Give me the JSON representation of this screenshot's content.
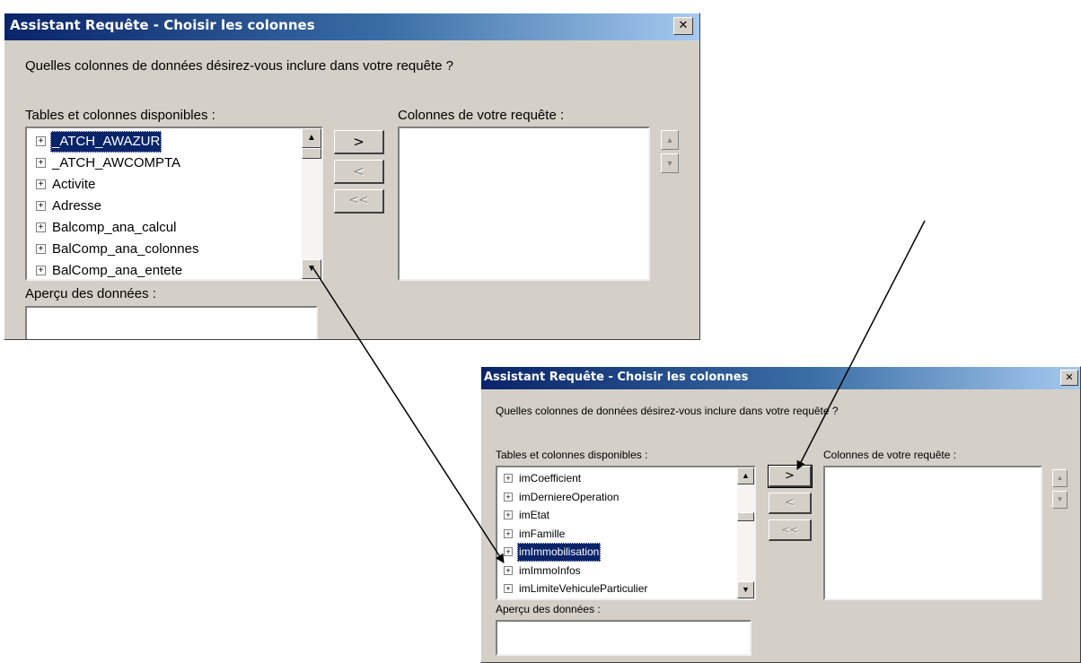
{
  "dialog1": {
    "title": "Assistant Requête - Choisir les colonnes",
    "close_glyph": "✕",
    "question": "Quelles colonnes de données désirez-vous inclure dans votre requête ?",
    "available_label": "Tables et colonnes disponibles :",
    "query_label": "Colonnes de votre requête :",
    "preview_label": "Aperçu des données :",
    "tree_items": [
      {
        "expander": "+",
        "label": "_ATCH_AWAZUR"
      },
      {
        "expander": "+",
        "label": "_ATCH_AWCOMPTA"
      },
      {
        "expander": "+",
        "label": "Activite"
      },
      {
        "expander": "+",
        "label": "Adresse"
      },
      {
        "expander": "+",
        "label": "Balcomp_ana_calcul"
      },
      {
        "expander": "+",
        "label": "BalComp_ana_colonnes"
      },
      {
        "expander": "+",
        "label": "BalComp_ana_entete"
      }
    ],
    "selected_index": 0,
    "buttons": {
      "add": ">",
      "remove": "<",
      "remove_all": "<<"
    },
    "move_up": "▲",
    "move_down": "▼"
  },
  "dialog2": {
    "title": "Assistant Requête - Choisir les colonnes",
    "close_glyph": "✕",
    "question": "Quelles colonnes de données désirez-vous inclure dans votre requête ?",
    "available_label": "Tables et colonnes disponibles :",
    "query_label": "Colonnes de votre requête :",
    "preview_label": "Aperçu des données :",
    "tree_items": [
      {
        "expander": "+",
        "label": "imCoefficient"
      },
      {
        "expander": "+",
        "label": "imDerniereOperation"
      },
      {
        "expander": "+",
        "label": "imEtat"
      },
      {
        "expander": "+",
        "label": "imFamille"
      },
      {
        "expander": "+",
        "label": "imImmobilisation"
      },
      {
        "expander": "+",
        "label": "imImmoInfos"
      },
      {
        "expander": "+",
        "label": "imLimiteVehiculeParticulier"
      }
    ],
    "selected_index": 4,
    "buttons": {
      "add": ">",
      "remove": "<",
      "remove_all": "<<"
    },
    "move_up": "▲",
    "move_down": "▼"
  },
  "scroll_glyphs": {
    "up": "▲",
    "down": "▼"
  },
  "colors": {
    "dialog_bg": "#d4d0c8",
    "title_start": "#0a246a",
    "title_end": "#a6caf0",
    "selection": "#0a246a",
    "arrow": "#000000"
  }
}
